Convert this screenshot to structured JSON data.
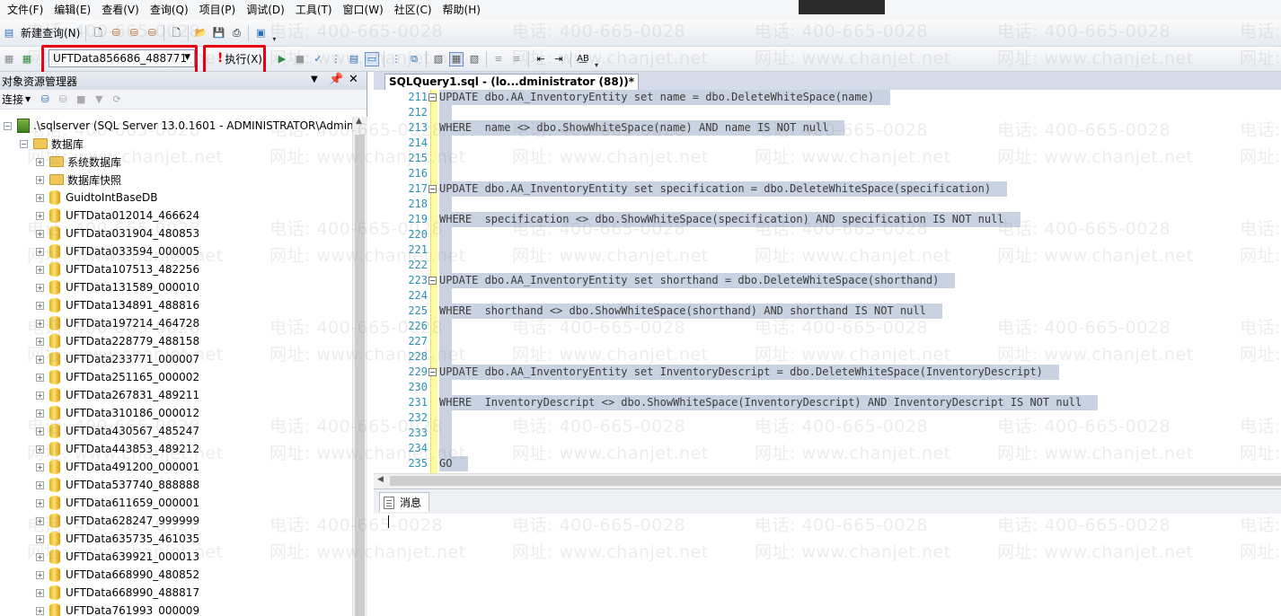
{
  "menu": [
    "文件(F)",
    "编辑(E)",
    "查看(V)",
    "查询(Q)",
    "项目(P)",
    "调试(D)",
    "工具(T)",
    "窗口(W)",
    "社区(C)",
    "帮助(H)"
  ],
  "toolbar": {
    "new_query_label": "新建查询(N)",
    "execute_label": "执行(X)",
    "database_selected": "UFTData856686_488771"
  },
  "object_explorer": {
    "title": "对象资源管理器",
    "connect_label": "连接",
    "server_node": ".\\sqlserver (SQL Server 13.0.1601 - ADMINISTRATOR\\Admini",
    "databases_label": "数据库",
    "folders": [
      "系统数据库",
      "数据库快照"
    ],
    "databases": [
      "GuidtoIntBaseDB",
      "UFTData012014_466624",
      "UFTData031904_480853",
      "UFTData033594_000005",
      "UFTData107513_482256",
      "UFTData131589_000010",
      "UFTData134891_488816",
      "UFTData197214_464728",
      "UFTData228779_488158",
      "UFTData233771_000007",
      "UFTData251165_000002",
      "UFTData267831_489211",
      "UFTData310186_000012",
      "UFTData430567_485247",
      "UFTData443853_489212",
      "UFTData491200_000001",
      "UFTData537740_888888",
      "UFTData611659_000001",
      "UFTData628247_999999",
      "UFTData635735_461035",
      "UFTData639921_000013",
      "UFTData668990_480852",
      "UFTData668990_488817",
      "UFTData761993_000009"
    ]
  },
  "editor": {
    "tab_title": "SQLQuery1.sql - (lo...dministrator (88))*",
    "lines": [
      {
        "n": "211",
        "t": "UPDATE dbo.AA_InventoryEntity set name = dbo.DeleteWhiteSpace(name)"
      },
      {
        "n": "212",
        "t": ""
      },
      {
        "n": "213",
        "t": "WHERE  name <> dbo.ShowWhiteSpace(name) AND name IS NOT null"
      },
      {
        "n": "214",
        "t": ""
      },
      {
        "n": "215",
        "t": ""
      },
      {
        "n": "216",
        "t": ""
      },
      {
        "n": "217",
        "t": "UPDATE dbo.AA_InventoryEntity set specification = dbo.DeleteWhiteSpace(specification)"
      },
      {
        "n": "218",
        "t": ""
      },
      {
        "n": "219",
        "t": "WHERE  specification <> dbo.ShowWhiteSpace(specification) AND specification IS NOT null"
      },
      {
        "n": "220",
        "t": ""
      },
      {
        "n": "221",
        "t": ""
      },
      {
        "n": "222",
        "t": ""
      },
      {
        "n": "223",
        "t": "UPDATE dbo.AA_InventoryEntity set shorthand = dbo.DeleteWhiteSpace(shorthand)"
      },
      {
        "n": "224",
        "t": ""
      },
      {
        "n": "225",
        "t": "WHERE  shorthand <> dbo.ShowWhiteSpace(shorthand) AND shorthand IS NOT null"
      },
      {
        "n": "226",
        "t": ""
      },
      {
        "n": "227",
        "t": ""
      },
      {
        "n": "228",
        "t": ""
      },
      {
        "n": "229",
        "t": "UPDATE dbo.AA_InventoryEntity set InventoryDescript = dbo.DeleteWhiteSpace(InventoryDescript)"
      },
      {
        "n": "230",
        "t": ""
      },
      {
        "n": "231",
        "t": "WHERE  InventoryDescript <> dbo.ShowWhiteSpace(InventoryDescript) AND InventoryDescript IS NOT null"
      },
      {
        "n": "232",
        "t": ""
      },
      {
        "n": "233",
        "t": ""
      },
      {
        "n": "234",
        "t": ""
      },
      {
        "n": "235",
        "t": "GO"
      }
    ]
  },
  "results": {
    "messages_tab": "消息"
  },
  "watermark": {
    "phone": "电话: 400-665-0028",
    "site": "网址: www.chanjet.net"
  },
  "colors": {
    "highlight_red": "#e60012",
    "selection": "#c8d2e0",
    "line_number": "#2b91af"
  }
}
